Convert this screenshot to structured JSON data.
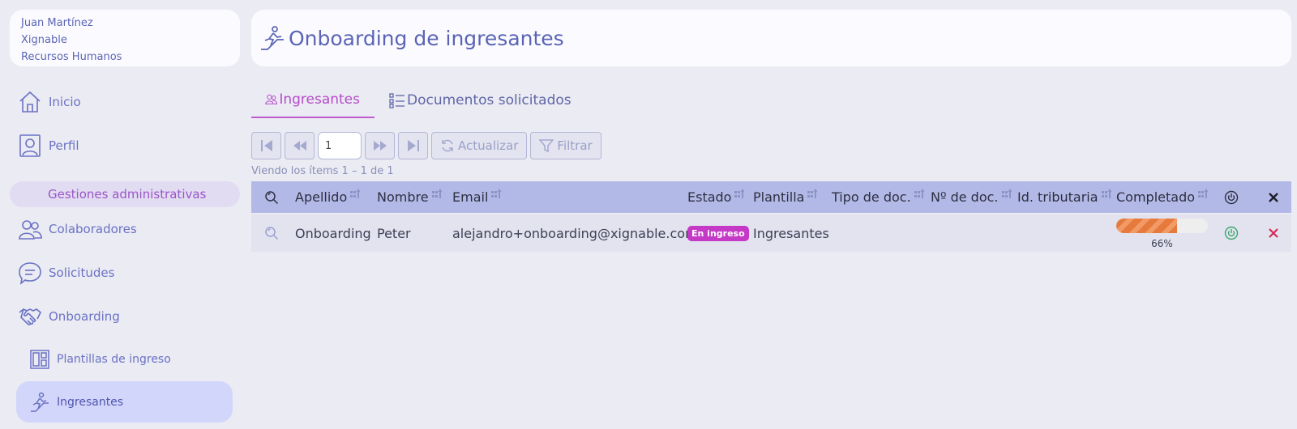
{
  "user": {
    "name": "Juan Martínez",
    "company": "Xignable",
    "department": "Recursos Humanos"
  },
  "sidebar": {
    "inicio": "Inicio",
    "perfil": "Perfil",
    "section": "Gestiones administrativas",
    "colaboradores": "Colaboradores",
    "solicitudes": "Solicitudes",
    "onboarding": "Onboarding",
    "plantillas": "Plantillas de ingreso",
    "ingresantes": "Ingresantes"
  },
  "header": {
    "title": "Onboarding de ingresantes"
  },
  "tabs": [
    {
      "label": "Ingresantes",
      "active": true
    },
    {
      "label": "Documentos solicitados",
      "active": false
    }
  ],
  "toolbar": {
    "page_value": "1",
    "refresh_label": "Actualizar",
    "filter_label": "Filtrar"
  },
  "items_info": "Viendo los ítems 1 – 1  de  1",
  "table": {
    "columns": [
      "Apellido",
      "Nombre",
      "Email",
      "Estado",
      "Plantilla",
      "Tipo de doc.",
      "Nº de doc.",
      "Id. tributaria",
      "Completado"
    ],
    "rows": [
      {
        "apellido": "Onboarding",
        "nombre": "Peter",
        "email": "alejandro+onboarding@xignable.com",
        "estado": "En ingreso",
        "plantilla": "Ingresantes",
        "tipo_doc": "",
        "num_doc": "",
        "id_tributaria": "",
        "completado": 66,
        "completado_label": "66%"
      }
    ]
  },
  "colors": {
    "accent": "#5b64b4",
    "active_tab": "#b44cc9",
    "header_row": "#b3b9e6",
    "badge": "#c539c7",
    "progress": "#e67a3c",
    "power_icon": "#3aa86a",
    "delete_icon": "#d22b55"
  }
}
